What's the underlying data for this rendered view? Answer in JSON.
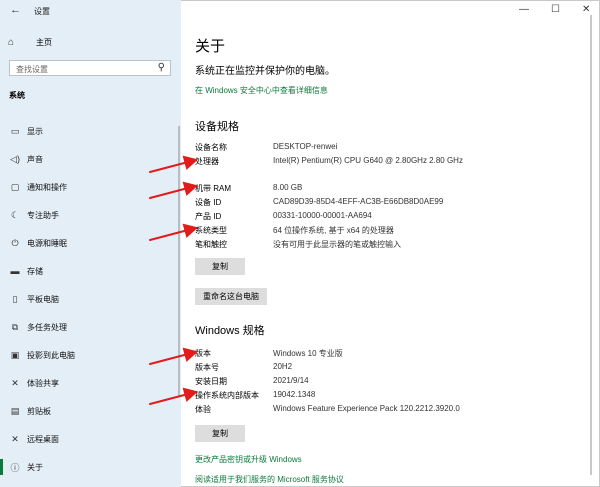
{
  "app": {
    "title": "设置",
    "back_icon": "back-arrow-icon"
  },
  "sidebar": {
    "home": "主页",
    "search_placeholder": "查找设置",
    "section": "系统",
    "items": [
      {
        "label": "显示",
        "icon": "display-icon",
        "glyph": "▭"
      },
      {
        "label": "声音",
        "icon": "speaker-icon",
        "glyph": "◁)"
      },
      {
        "label": "通知和操作",
        "icon": "notification-icon",
        "glyph": "▢"
      },
      {
        "label": "专注助手",
        "icon": "moon-icon",
        "glyph": "☾"
      },
      {
        "label": "电源和睡眠",
        "icon": "power-icon",
        "glyph": "⏻"
      },
      {
        "label": "存储",
        "icon": "storage-icon",
        "glyph": "▬"
      },
      {
        "label": "平板电脑",
        "icon": "tablet-icon",
        "glyph": "▯"
      },
      {
        "label": "多任务处理",
        "icon": "multitask-icon",
        "glyph": "⧉"
      },
      {
        "label": "投影到此电脑",
        "icon": "project-icon",
        "glyph": "▣"
      },
      {
        "label": "体验共享",
        "icon": "share-icon",
        "glyph": "✕"
      },
      {
        "label": "剪贴板",
        "icon": "clipboard-icon",
        "glyph": "▤"
      },
      {
        "label": "远程桌面",
        "icon": "remote-desktop-icon",
        "glyph": "✕"
      },
      {
        "label": "关于",
        "icon": "info-icon",
        "glyph": "ⓘ"
      }
    ],
    "active_index": 12
  },
  "main": {
    "title": "关于",
    "subtitle": "系统正在监控并保护你的电脑。",
    "security_link": "在 Windows 安全中心中查看详细信息",
    "device_specs": {
      "heading": "设备规格",
      "rows": [
        {
          "k": "设备名称",
          "v": "DESKTOP-renwei"
        },
        {
          "k": "处理器",
          "v": "Intel(R) Pentium(R) CPU G640 @ 2.80GHz   2.80 GHz"
        },
        {
          "k": "机带 RAM",
          "v": "8.00 GB"
        },
        {
          "k": "设备 ID",
          "v": "CAD89D39-85D4-4EFF-AC3B-E66DB8D0AE99"
        },
        {
          "k": "产品 ID",
          "v": "00331-10000-00001-AA694"
        },
        {
          "k": "系统类型",
          "v": "64 位操作系统, 基于 x64 的处理器"
        },
        {
          "k": "笔和触控",
          "v": "没有可用于此显示器的笔或触控输入"
        }
      ],
      "copy_button": "复制",
      "rename_button": "重命名这台电脑"
    },
    "windows_specs": {
      "heading": "Windows 规格",
      "rows": [
        {
          "k": "版本",
          "v": "Windows 10 专业版"
        },
        {
          "k": "版本号",
          "v": "20H2"
        },
        {
          "k": "安装日期",
          "v": "2021/9/14"
        },
        {
          "k": "操作系统内部版本",
          "v": "19042.1348"
        },
        {
          "k": "体验",
          "v": "Windows Feature Experience Pack 120.2212.3920.0"
        }
      ],
      "copy_button": "复制"
    },
    "links": {
      "upgrade": "更改产品密钥或升级 Windows",
      "service_agreement": "阅读适用于我们服务的 Microsoft 服务协议"
    }
  },
  "window_controls": {
    "minimize": "—",
    "maximize": "☐",
    "close": "✕"
  },
  "colors": {
    "sidebar_bg": "#e4eef6",
    "link": "#0b7a3b",
    "accent": "#0b7a3b",
    "arrow": "#e21b1b"
  }
}
